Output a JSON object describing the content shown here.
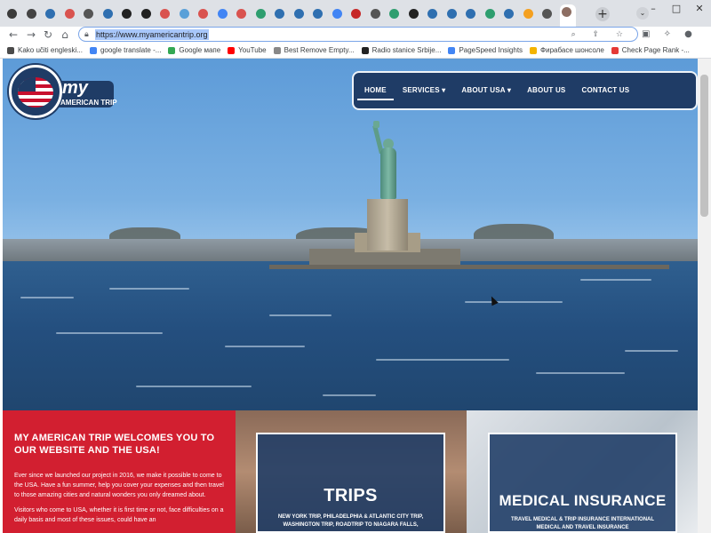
{
  "browser": {
    "url": "https://www.myamericantrip.org",
    "tabs_visible": 30,
    "new_tab_label": "+",
    "window_controls": [
      "–",
      "□",
      "✕"
    ],
    "tab_search_icon": "⌄",
    "nav": {
      "back": "←",
      "forward": "→",
      "reload": "↻",
      "home": "⌂"
    },
    "omnibox_icons": "⌕ ⇪ ☆",
    "toolbar_right_icons": "▣ ✧ ● ⋮",
    "bookmarks": [
      {
        "label": "Kako učiti engleski...",
        "color": "#4a4a4a"
      },
      {
        "label": "google translate -...",
        "color": "#4285f4"
      },
      {
        "label": "Google мапе",
        "color": "#34a853"
      },
      {
        "label": "YouTube",
        "color": "#ff0000"
      },
      {
        "label": "Best Remove Empty...",
        "color": "#888888"
      },
      {
        "label": "Radio stanice Srbije...",
        "color": "#222222"
      },
      {
        "label": "PageSpeed Insights",
        "color": "#4285f4"
      },
      {
        "label": "Фирабасе шонсоле",
        "color": "#f4b400"
      },
      {
        "label": "Check Page Rank -...",
        "color": "#e53935"
      }
    ]
  },
  "site": {
    "logo": {
      "my": "my",
      "sub": "AMERICAN TRIP"
    },
    "nav": [
      {
        "label": "HOME",
        "active": true
      },
      {
        "label": "SERVICES ▾"
      },
      {
        "label": "ABOUT USA ▾"
      },
      {
        "label": "ABOUT US"
      },
      {
        "label": "CONTACT US"
      }
    ],
    "welcome": {
      "title": "MY AMERICAN TRIP WELCOMES YOU TO OUR WEBSITE AND THE USA!",
      "paragraph1": "Ever since we launched our project in 2016, we make it possible to come to the USA. Have a fun summer, help you cover your expenses and then travel to those amazing cities and natural wonders you only dreamed about.",
      "paragraph2": "Visitors who come to USA, whether it is first time or not, face difficulties on a daily basis and most of these issues, could have an"
    },
    "cards": {
      "trips": {
        "title": "TRIPS",
        "subtitle": "NEW YORK TRIP, PHILADELPHIA & ATLANTIC CITY TRIP, WASHINGTON TRIP, ROADTRIP TO NIAGARA FALLS,"
      },
      "medical": {
        "title": "MEDICAL INSURANCE",
        "subtitle": "TRAVEL MEDICAL & TRIP INSURANCE INTERNATIONAL MEDICAL AND TRAVEL INSURANCE"
      }
    }
  }
}
